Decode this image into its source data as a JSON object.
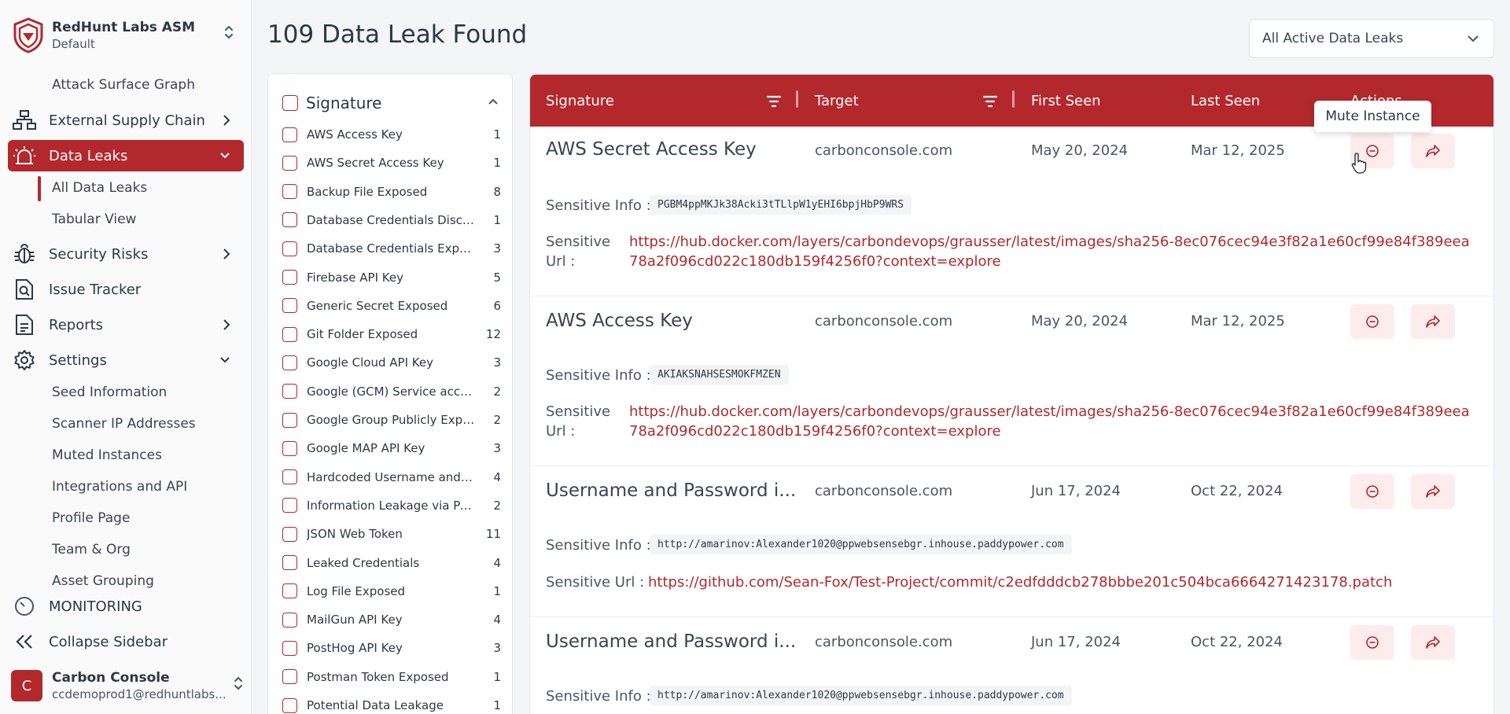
{
  "org": {
    "name": "RedHunt Labs ASM",
    "sub": "Default"
  },
  "sidebar": {
    "top_sub": "Attack Surface Graph",
    "items": [
      {
        "label": "External Supply Chain",
        "icon": "network-icon"
      },
      {
        "label": "Data Leaks",
        "icon": "siren-icon"
      },
      {
        "label": "Security Risks",
        "icon": "bug-icon"
      },
      {
        "label": "Issue Tracker",
        "icon": "search-doc-icon"
      },
      {
        "label": "Reports",
        "icon": "report-icon"
      },
      {
        "label": "Settings",
        "icon": "gear-icon"
      }
    ],
    "data_leaks_sub": [
      "All Data Leaks",
      "Tabular View"
    ],
    "settings_sub": [
      "Seed Information",
      "Scanner IP Addresses",
      "Muted Instances",
      "Integrations and API",
      "Profile Page",
      "Team & Org",
      "Asset Grouping"
    ],
    "monitoring": "MONITORING",
    "collapse": "Collapse Sidebar"
  },
  "user": {
    "initial": "C",
    "name": "Carbon Console",
    "email": "ccdemoprod1@redhuntlabs..."
  },
  "header": {
    "title": "109 Data Leak Found",
    "filter": "All Active Data Leaks"
  },
  "signature_panel": {
    "title": "Signature",
    "items": [
      {
        "label": "AWS Access Key",
        "count": "1"
      },
      {
        "label": "AWS Secret Access Key",
        "count": "1"
      },
      {
        "label": "Backup File Exposed",
        "count": "8"
      },
      {
        "label": "Database Credentials Disclosed",
        "count": "1"
      },
      {
        "label": "Database Credentials Exposed",
        "count": "3"
      },
      {
        "label": "Firebase API Key",
        "count": "5"
      },
      {
        "label": "Generic Secret Exposed",
        "count": "6"
      },
      {
        "label": "Git Folder Exposed",
        "count": "12"
      },
      {
        "label": "Google Cloud API Key",
        "count": "3"
      },
      {
        "label": "Google (GCM) Service account",
        "count": "2"
      },
      {
        "label": "Google Group Publicly Exposed",
        "count": "2"
      },
      {
        "label": "Google MAP API Key",
        "count": "3"
      },
      {
        "label": "Hardcoded Username and Pas...",
        "count": "4"
      },
      {
        "label": "Information Leakage via Paste...",
        "count": "2"
      },
      {
        "label": "JSON Web Token",
        "count": "11"
      },
      {
        "label": "Leaked Credentials",
        "count": "4"
      },
      {
        "label": "Log File Exposed",
        "count": "1"
      },
      {
        "label": "MailGun API Key",
        "count": "4"
      },
      {
        "label": "PostHog API Key",
        "count": "3"
      },
      {
        "label": "Postman Token Exposed",
        "count": "1"
      },
      {
        "label": "Potential Data Leakage",
        "count": "1"
      }
    ]
  },
  "table": {
    "columns": {
      "signature": "Signature",
      "target": "Target",
      "first_seen": "First Seen",
      "last_seen": "Last Seen",
      "actions": "Actions"
    },
    "info_label": "Sensitive Info :",
    "url_label_1": "Sensitive",
    "url_label_2": "Url :",
    "url_label": "Sensitive Url :",
    "rows": [
      {
        "signature": "AWS Secret Access Key",
        "target": "carbonconsole.com",
        "first_seen": "May 20, 2024",
        "last_seen": "Mar 12, 2025",
        "info": "PGBM4ppMKJk38Acki3tTLlpW1yEHI6bpjHbP9WRS",
        "url": "https://hub.docker.com/layers/carbondevops/grausser/latest/images/sha256-8ec076cec94e3f82a1e60cf99e84f389eea78a2f096cd022c180db159f4256f0?context=explore"
      },
      {
        "signature": "AWS Access Key",
        "target": "carbonconsole.com",
        "first_seen": "May 20, 2024",
        "last_seen": "Mar 12, 2025",
        "info": "AKIAKSNAHSESMOKFMZEN",
        "url": "https://hub.docker.com/layers/carbondevops/grausser/latest/images/sha256-8ec076cec94e3f82a1e60cf99e84f389eea78a2f096cd022c180db159f4256f0?context=explore"
      },
      {
        "signature": "Username and Password i...",
        "target": "carbonconsole.com",
        "first_seen": "Jun 17, 2024",
        "last_seen": "Oct 22, 2024",
        "info": "http://amarinov:Alexander1020@ppwebsensebgr.inhouse.paddypower.com",
        "url": "https://github.com/Sean-Fox/Test-Project/commit/c2edfdddcb278bbbe201c504bca6664271423178.patch"
      },
      {
        "signature": "Username and Password i...",
        "target": "carbonconsole.com",
        "first_seen": "Jun 17, 2024",
        "last_seen": "Oct 22, 2024",
        "info": "http://amarinov:Alexander1020@ppwebsensebgr.inhouse.paddypower.com"
      }
    ]
  },
  "tooltip": "Mute Instance",
  "colors": {
    "accent": "#b3282c",
    "accent_light": "#fcecec"
  }
}
